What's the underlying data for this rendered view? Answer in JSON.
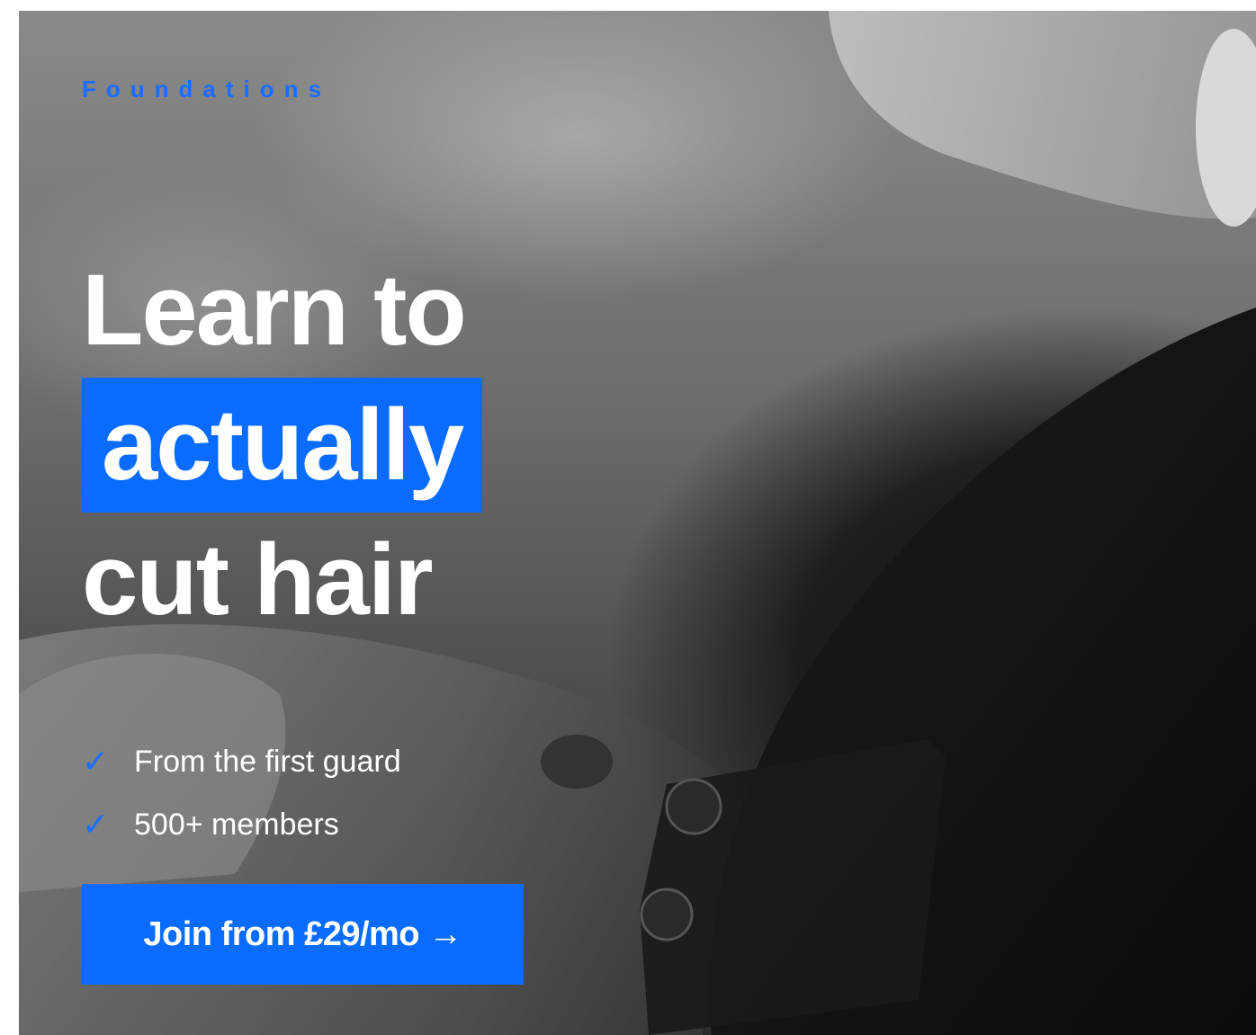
{
  "hero": {
    "eyebrow": "Foundations",
    "headline": {
      "line1": "Learn to",
      "highlight": "actually",
      "line3": "cut hair"
    },
    "features": [
      {
        "icon": "check-icon",
        "text": "From the first guard"
      },
      {
        "icon": "check-icon",
        "text": "500+ members"
      }
    ],
    "cta_label": "Join from £29/mo →"
  },
  "colors": {
    "accent": "#0a6cff",
    "text": "#ffffff"
  }
}
